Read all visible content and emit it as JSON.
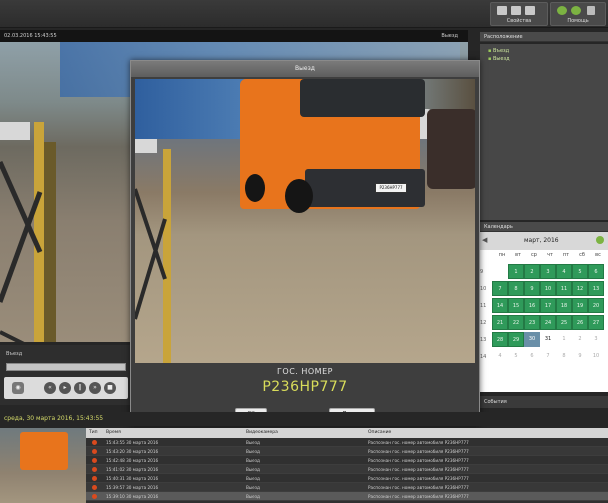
{
  "toolbar": {
    "group1_label": "Свойства",
    "group2_label": "Помощь"
  },
  "video": {
    "title_left": "02.03.2016  15:43:55",
    "title_right": "Выезд"
  },
  "right_panel": {
    "tree_header": "Расположение",
    "tree_items": [
      "Въезд",
      "Выезд"
    ],
    "calendar_header": "Календарь",
    "calendar_month": "март, 2016",
    "weekdays": [
      "пн",
      "вт",
      "ср",
      "чт",
      "пт",
      "сб",
      "вс"
    ],
    "week_numbers": [
      "9",
      "10",
      "11",
      "12",
      "13",
      "14"
    ],
    "days": [
      [
        "",
        "1",
        "2",
        "3",
        "4",
        "5",
        "6"
      ],
      [
        "7",
        "8",
        "9",
        "10",
        "11",
        "12",
        "13"
      ],
      [
        "14",
        "15",
        "16",
        "17",
        "18",
        "19",
        "20"
      ],
      [
        "21",
        "22",
        "23",
        "24",
        "25",
        "26",
        "27"
      ],
      [
        "28",
        "29",
        "30",
        "31",
        "1",
        "2",
        "3"
      ],
      [
        "4",
        "5",
        "6",
        "7",
        "8",
        "9",
        "10"
      ]
    ],
    "bottom_label": "События"
  },
  "controls": {
    "label": "Въезд"
  },
  "modal": {
    "title": "Выезд",
    "plate_label": "ГОС. НОМЕР",
    "plate_number": "Р236НР777",
    "photo_plate": "Р236НР777",
    "ok_button": "OK",
    "print_button": "Печать"
  },
  "status_line": "среда, 30 марта 2016,  15:43:55",
  "events": {
    "columns": [
      "Тип",
      "Время",
      "Видеокамера",
      "Описание"
    ],
    "rows": [
      {
        "time": "15:43:55  30 марта 2016",
        "camera": "Выезд",
        "desc": "Распознан гос. номер автомобиля Р236НР777"
      },
      {
        "time": "15:43:20  30 марта 2016",
        "camera": "Выезд",
        "desc": "Распознан гос. номер автомобиля Р236НР777"
      },
      {
        "time": "15:42:48  30 марта 2016",
        "camera": "Выезд",
        "desc": "Распознан гос. номер автомобиля Р236НР777"
      },
      {
        "time": "15:41:02  30 марта 2016",
        "camera": "Выезд",
        "desc": "Распознан гос. номер автомобиля Р236НР777"
      },
      {
        "time": "15:40:31  30 марта 2016",
        "camera": "Выезд",
        "desc": "Распознан гос. номер автомобиля Р236НР777"
      },
      {
        "time": "15:39:57  30 марта 2016",
        "camera": "Выезд",
        "desc": "Распознан гос. номер автомобиля Р236НР777"
      },
      {
        "time": "15:39:10  30 марта 2016",
        "camera": "Выезд",
        "desc": "Распознан гос. номер автомобиля Р236НР777"
      }
    ]
  }
}
